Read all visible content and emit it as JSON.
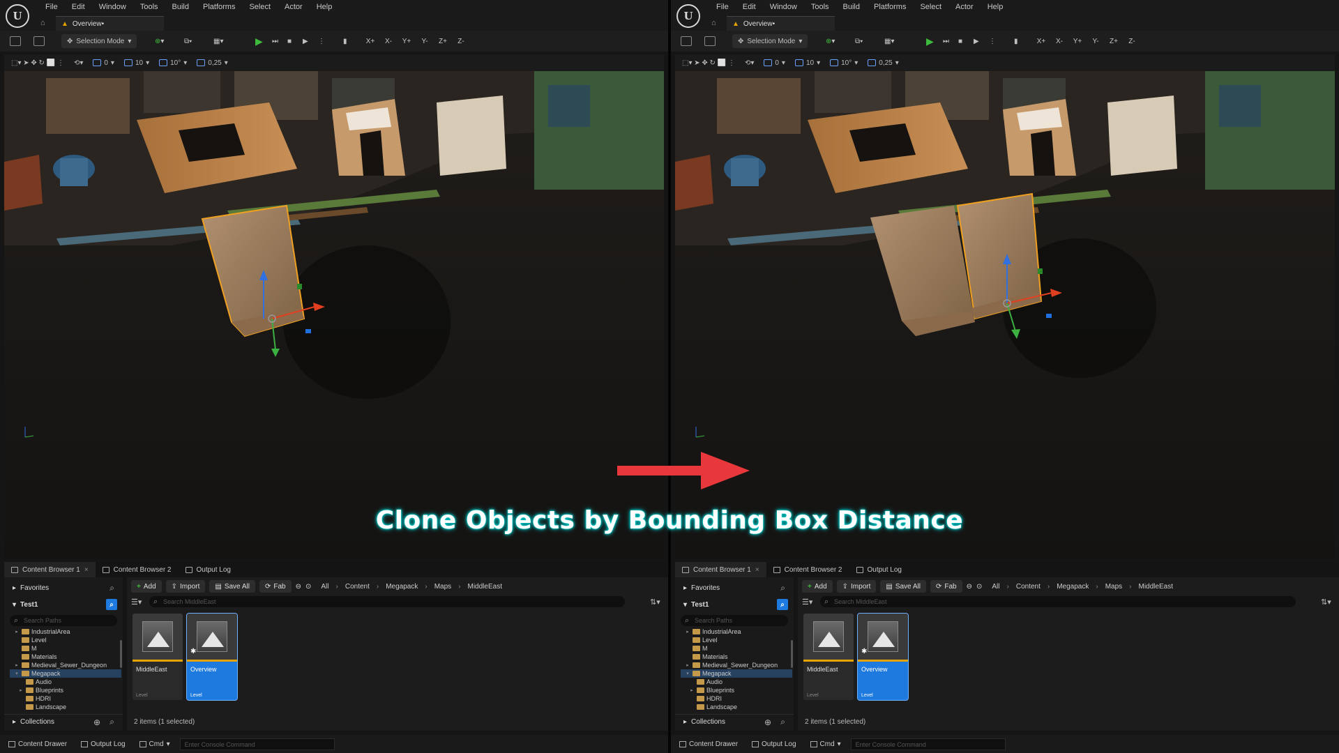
{
  "menu": [
    "File",
    "Edit",
    "Window",
    "Tools",
    "Build",
    "Platforms",
    "Select",
    "Actor",
    "Help"
  ],
  "doc_tab": {
    "title": "Overview•"
  },
  "toolbar": {
    "selection_mode": "Selection Mode",
    "axes": [
      "X+",
      "X-",
      "Y+",
      "Y-",
      "Z+",
      "Z-"
    ]
  },
  "viewport_bar": {
    "surface_snap": "0",
    "grid_snap": "10",
    "rotation_snap": "10°",
    "scale_snap": "0,25"
  },
  "content_browser": {
    "tabs": [
      "Content Browser 1",
      "Content Browser 2",
      "Output Log"
    ],
    "favorites": "Favorites",
    "project": "Test1",
    "search_paths_placeholder": "Search Paths",
    "tree": [
      {
        "label": "IndustrialArea",
        "indent": 1,
        "arrow": "▸"
      },
      {
        "label": "Level",
        "indent": 1,
        "arrow": ""
      },
      {
        "label": "M",
        "indent": 1,
        "arrow": ""
      },
      {
        "label": "Materials",
        "indent": 1,
        "arrow": ""
      },
      {
        "label": "Medieval_Sewer_Dungeon",
        "indent": 1,
        "arrow": "▸"
      },
      {
        "label": "Megapack",
        "indent": 1,
        "arrow": "▾",
        "selected": true
      },
      {
        "label": "Audio",
        "indent": 2,
        "arrow": ""
      },
      {
        "label": "Blueprints",
        "indent": 2,
        "arrow": "▸"
      },
      {
        "label": "HDRI",
        "indent": 2,
        "arrow": ""
      },
      {
        "label": "Landscape",
        "indent": 2,
        "arrow": ""
      }
    ],
    "collections": "Collections",
    "buttons": {
      "add": "Add",
      "import": "Import",
      "save_all": "Save All",
      "fab": "Fab"
    },
    "breadcrumb": [
      "All",
      "Content",
      "Megapack",
      "Maps",
      "MiddleEast"
    ],
    "search_placeholder": "Search MiddleEast",
    "assets": [
      {
        "name": "MiddleEast",
        "type": "Level",
        "selected": false
      },
      {
        "name": "Overview",
        "type": "Level",
        "selected": true
      }
    ],
    "status": "2 items (1 selected)"
  },
  "statusbar": {
    "content_drawer": "Content Drawer",
    "output_log": "Output Log",
    "cmd": "Cmd",
    "console_placeholder": "Enter Console Command"
  },
  "caption": "Clone Objects by Bounding Box Distance",
  "colors": {
    "accent": "#1f7ae0",
    "arrow": "#e8383b",
    "caption_glow": "#00d4d4",
    "selection_outline": "#f0a020"
  }
}
